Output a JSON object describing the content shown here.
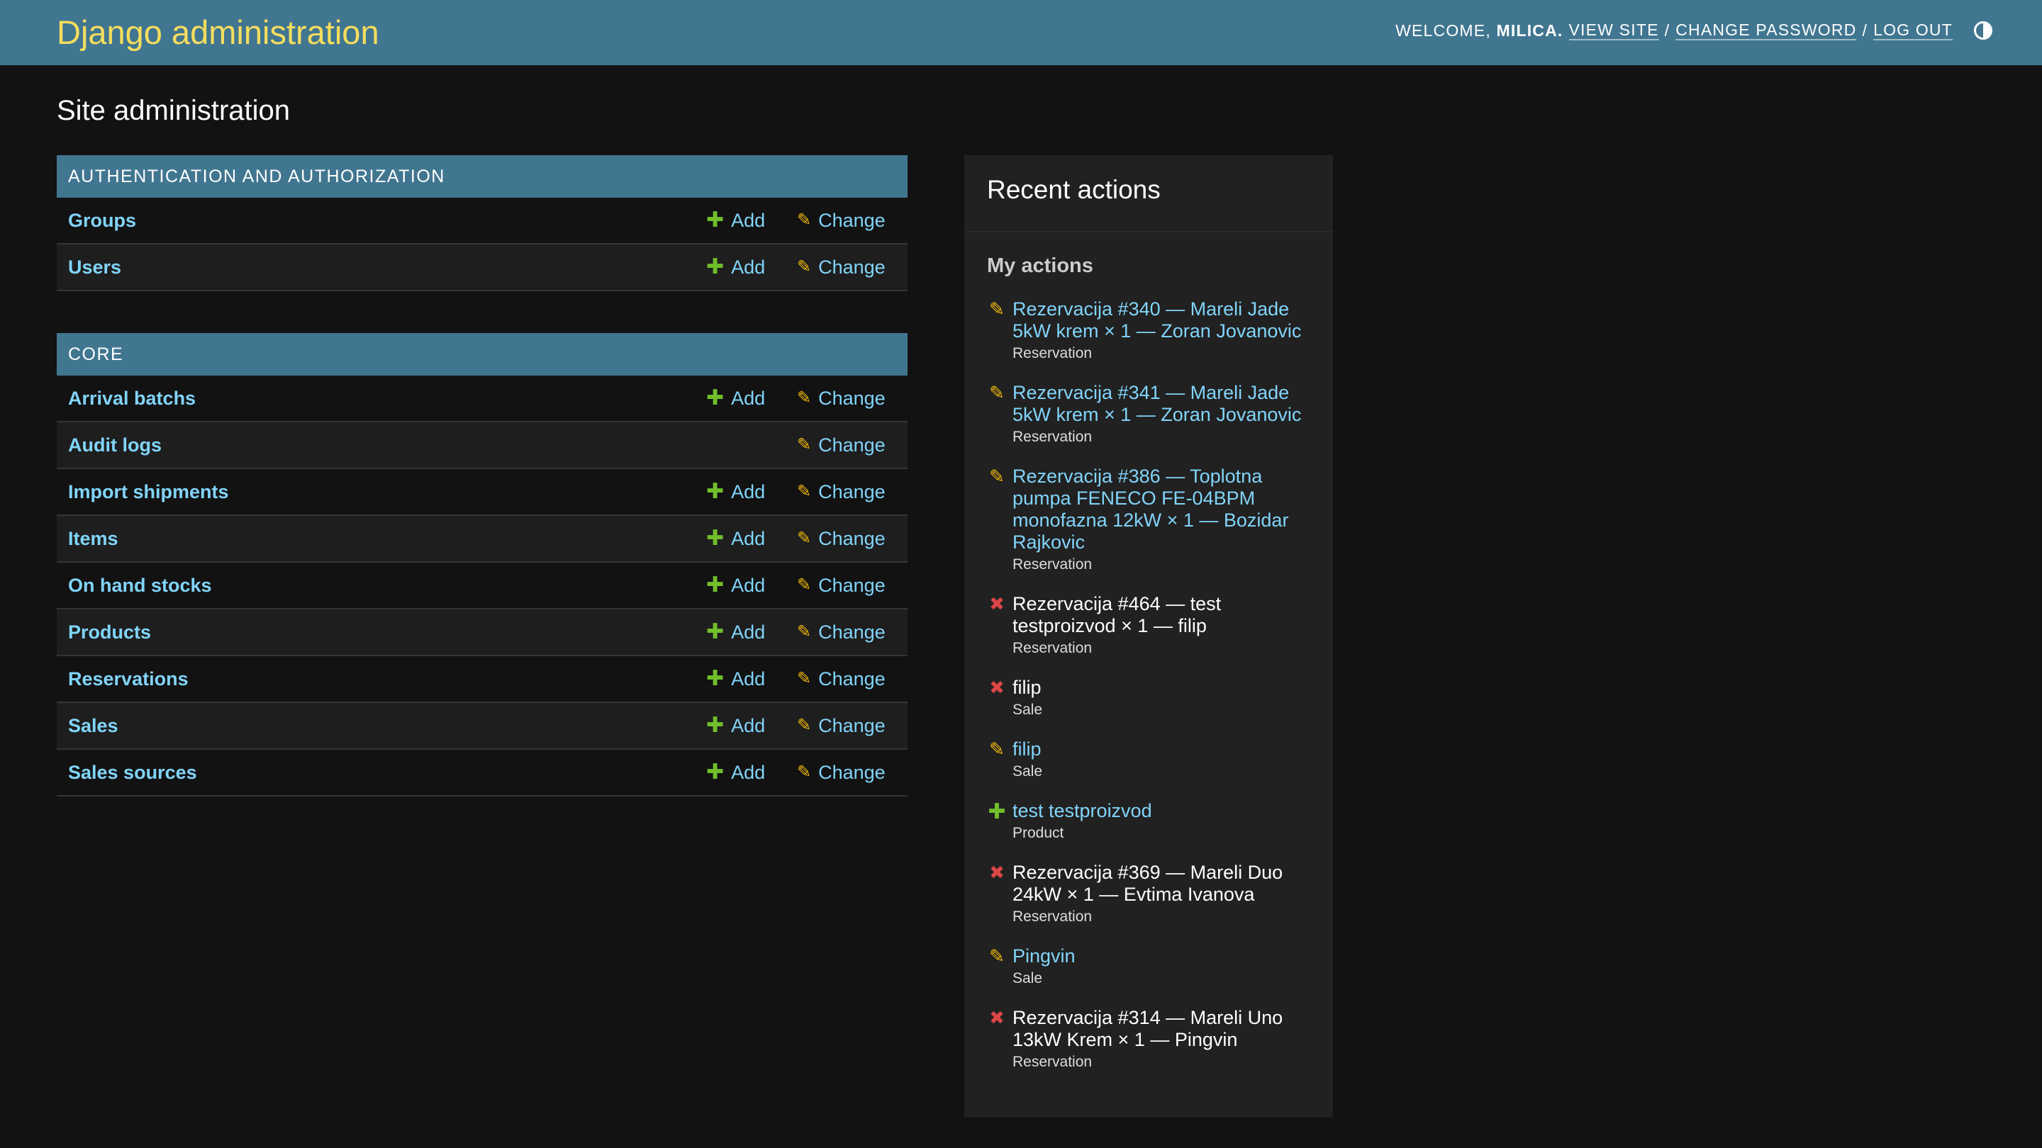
{
  "header": {
    "branding": "Django administration",
    "welcome": "WELCOME,",
    "username": "MILICA.",
    "view_site": "VIEW SITE",
    "change_password": "CHANGE PASSWORD",
    "log_out": "LOG OUT",
    "separator": "/",
    "theme_icon": "contrast-half-circle-icon"
  },
  "page_title": "Site administration",
  "modules": [
    {
      "caption": "AUTHENTICATION AND AUTHORIZATION",
      "models": [
        {
          "name": "Groups",
          "add": "Add",
          "change": "Change"
        },
        {
          "name": "Users",
          "add": "Add",
          "change": "Change"
        }
      ]
    },
    {
      "caption": "CORE",
      "models": [
        {
          "name": "Arrival batchs",
          "add": "Add",
          "change": "Change"
        },
        {
          "name": "Audit logs",
          "add": null,
          "change": "Change"
        },
        {
          "name": "Import shipments",
          "add": "Add",
          "change": "Change"
        },
        {
          "name": "Items",
          "add": "Add",
          "change": "Change"
        },
        {
          "name": "On hand stocks",
          "add": "Add",
          "change": "Change"
        },
        {
          "name": "Products",
          "add": "Add",
          "change": "Change"
        },
        {
          "name": "Reservations",
          "add": "Add",
          "change": "Change"
        },
        {
          "name": "Sales",
          "add": "Add",
          "change": "Change"
        },
        {
          "name": "Sales sources",
          "add": "Add",
          "change": "Change"
        }
      ]
    }
  ],
  "recent_actions": {
    "title": "Recent actions",
    "subtitle": "My actions",
    "items": [
      {
        "action": "change",
        "title": "Rezervacija #340 — Mareli Jade 5kW krem × 1 — Zoran Jovanovic",
        "type": "Reservation"
      },
      {
        "action": "change",
        "title": "Rezervacija #341 — Mareli Jade 5kW krem × 1 — Zoran Jovanovic",
        "type": "Reservation"
      },
      {
        "action": "change",
        "title": "Rezervacija #386 — Toplotna pumpa FENECO FE-04BPM monofazna 12kW × 1 — Bozidar Rajkovic",
        "type": "Reservation"
      },
      {
        "action": "delete",
        "title": "Rezervacija #464 — test testproizvod × 1 — filip",
        "type": "Reservation"
      },
      {
        "action": "delete",
        "title": "filip",
        "type": "Sale"
      },
      {
        "action": "change",
        "title": "filip",
        "type": "Sale"
      },
      {
        "action": "add",
        "title": "test testproizvod",
        "type": "Product"
      },
      {
        "action": "delete",
        "title": "Rezervacija #369 — Mareli Duo 24kW × 1 — Evtima Ivanova",
        "type": "Reservation"
      },
      {
        "action": "change",
        "title": "Pingvin",
        "type": "Sale"
      },
      {
        "action": "delete",
        "title": "Rezervacija #314 — Mareli Uno 13kW Krem × 1 — Pingvin",
        "type": "Reservation"
      }
    ]
  },
  "colors": {
    "header_bg": "#417690",
    "branding": "#f5dd5d",
    "link": "#81d4fa",
    "add_icon": "#70bf2b",
    "change_icon": "#efb80b",
    "delete_icon": "#dd4646"
  }
}
